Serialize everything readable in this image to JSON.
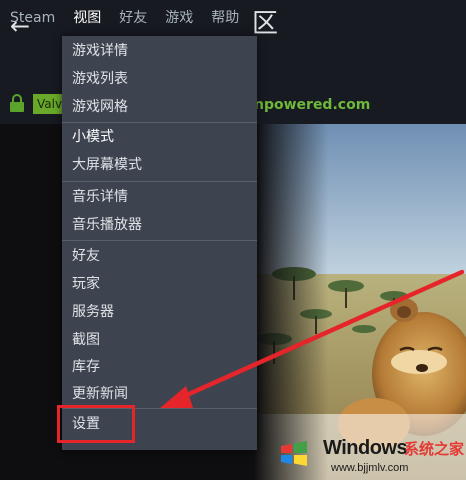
{
  "menubar": {
    "items": [
      "Steam",
      "视图",
      "好友",
      "游戏",
      "帮助"
    ]
  },
  "nav": {
    "title_fragment": "区"
  },
  "urlbar": {
    "cert_label": "Valv",
    "url_fragment": "npowered.com"
  },
  "dropdown": {
    "groups": [
      [
        "游戏详情",
        "游戏列表",
        "游戏网格"
      ],
      [
        "小模式",
        "大屏幕模式"
      ],
      [
        "音乐详情",
        "音乐播放器"
      ],
      [
        "好友",
        "玩家",
        "服务器",
        "截图",
        "库存",
        "更新新闻"
      ],
      [
        "设置"
      ]
    ]
  },
  "annotation": {
    "arrow_color": "#e5252a",
    "highlight_target": "设置"
  },
  "watermark": {
    "brand": "Windows",
    "cn_text": "系统之家",
    "url": "www.bjjmlv.com"
  }
}
